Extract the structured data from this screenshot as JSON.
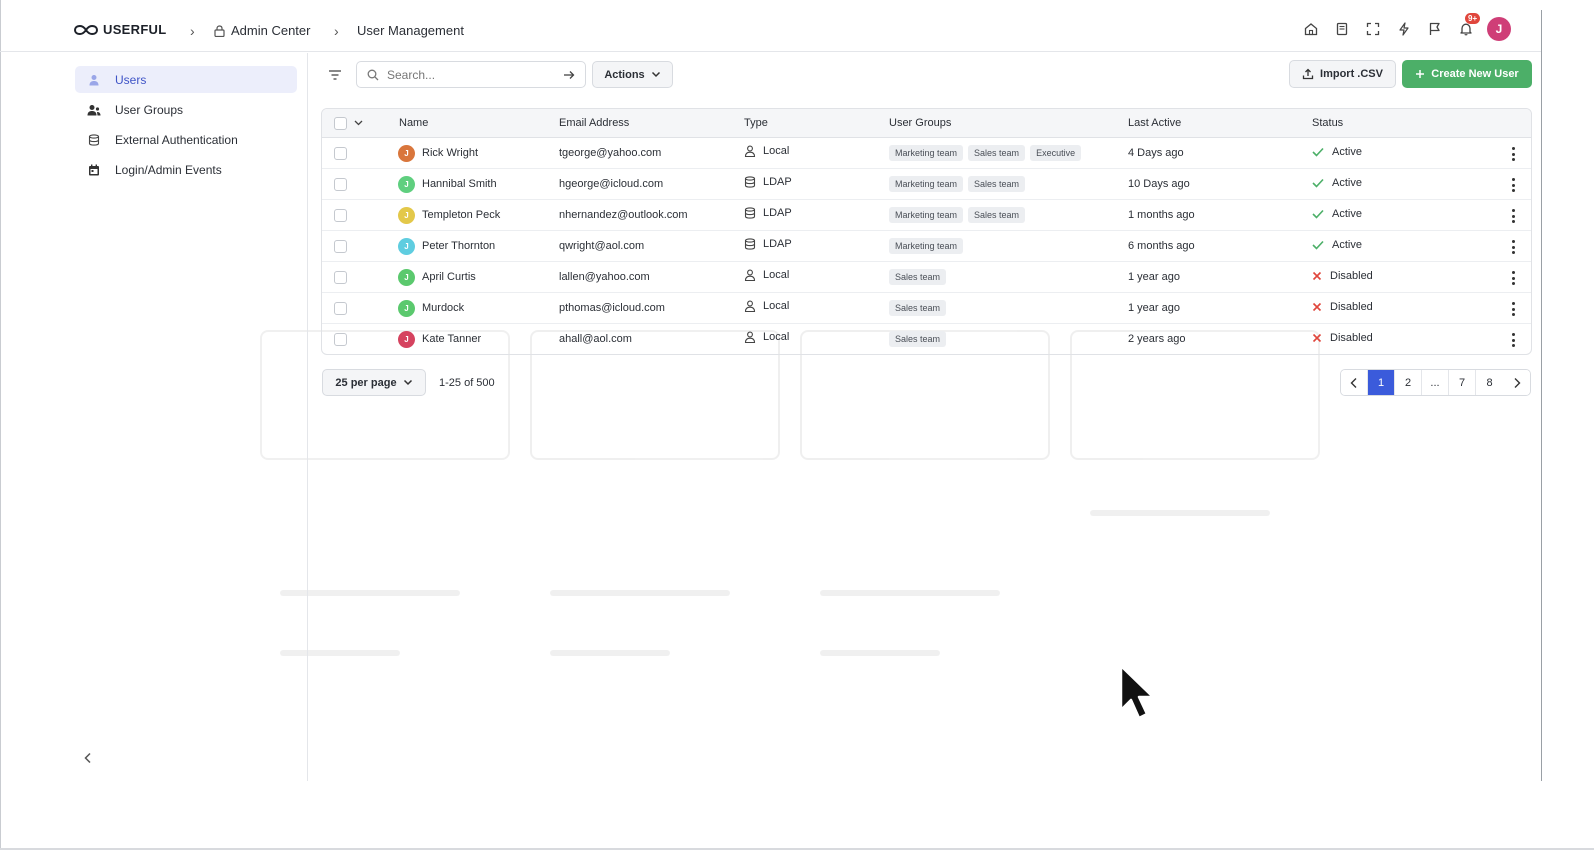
{
  "app": {
    "logo_text": "USERFUL",
    "breadcrumbs": [
      "Admin Center",
      "User Management"
    ],
    "notification_badge": "9+",
    "user_initial": "J"
  },
  "sidebar": {
    "items": [
      {
        "label": "Users",
        "icon": "user-icon",
        "active": true
      },
      {
        "label": "User Groups",
        "icon": "user-groups-icon",
        "active": false
      },
      {
        "label": "External Authentication",
        "icon": "database-icon",
        "active": false
      },
      {
        "label": "Login/Admin Events",
        "icon": "calendar-icon",
        "active": false
      }
    ]
  },
  "toolbar": {
    "search_placeholder": "Search...",
    "actions_label": "Actions",
    "import_label": "Import .CSV",
    "create_label": "Create New User"
  },
  "table": {
    "columns": [
      "Name",
      "Email Address",
      "Type",
      "User Groups",
      "Last Active",
      "Status"
    ],
    "rows": [
      {
        "initial": "J",
        "avatar_color": "#d9763c",
        "name": "Rick Wright",
        "email": "tgeorge@yahoo.com",
        "type": "Local",
        "type_icon": "person-icon",
        "groups": [
          "Marketing team",
          "Sales team",
          "Executive"
        ],
        "last_active": "4 Days ago",
        "status": "Active"
      },
      {
        "initial": "J",
        "avatar_color": "#5fcf7f",
        "name": "Hannibal Smith",
        "email": "hgeorge@icloud.com",
        "type": "LDAP",
        "type_icon": "database-icon",
        "groups": [
          "Marketing team",
          "Sales team"
        ],
        "last_active": "10 Days ago",
        "status": "Active"
      },
      {
        "initial": "J",
        "avatar_color": "#e3c84a",
        "name": "Templeton Peck",
        "email": "nhernandez@outlook.com",
        "type": "LDAP",
        "type_icon": "database-icon",
        "groups": [
          "Marketing team",
          "Sales team"
        ],
        "last_active": "1 months ago",
        "status": "Active"
      },
      {
        "initial": "J",
        "avatar_color": "#5fcde0",
        "name": "Peter Thornton",
        "email": "qwright@aol.com",
        "type": "LDAP",
        "type_icon": "database-icon",
        "groups": [
          "Marketing team"
        ],
        "last_active": "6 months ago",
        "status": "Active"
      },
      {
        "initial": "J",
        "avatar_color": "#5bc96e",
        "name": "April Curtis",
        "email": "lallen@yahoo.com",
        "type": "Local",
        "type_icon": "person-icon",
        "groups": [
          "Sales team"
        ],
        "last_active": "1 year ago",
        "status": "Disabled"
      },
      {
        "initial": "J",
        "avatar_color": "#5bc96e",
        "name": "Murdock",
        "email": "pthomas@icloud.com",
        "type": "Local",
        "type_icon": "person-icon",
        "groups": [
          "Sales team"
        ],
        "last_active": "1 year ago",
        "status": "Disabled"
      },
      {
        "initial": "J",
        "avatar_color": "#d5435f",
        "name": "Kate Tanner",
        "email": "ahall@aol.com",
        "type": "Local",
        "type_icon": "person-icon",
        "groups": [
          "Sales team"
        ],
        "last_active": "2 years ago",
        "status": "Disabled"
      }
    ]
  },
  "footer": {
    "per_page_label": "25 per page",
    "range_text": "1-25 of 500",
    "pages": [
      "1",
      "2",
      "...",
      "7",
      "8"
    ],
    "current_page": "1"
  },
  "colors": {
    "accent": "#3b5bdb",
    "primary_button": "#4caf68",
    "active_status": "#4caf68",
    "disabled_status": "#e0463c"
  }
}
